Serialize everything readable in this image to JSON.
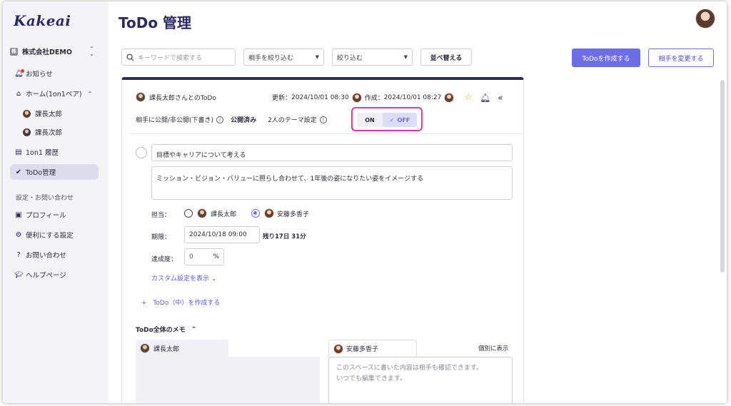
{
  "app": {
    "logo": "Kakeai"
  },
  "sidebar": {
    "company": "株式会社DEMO",
    "company_icon": "株",
    "items": [
      {
        "label": "お知らせ"
      },
      {
        "label": "ホーム(1on1ペア)"
      },
      {
        "label": "課長太郎"
      },
      {
        "label": "課長次郎"
      },
      {
        "label": "1on1 履歴"
      },
      {
        "label": "ToDo管理"
      }
    ],
    "section": "設定・お問い合わせ",
    "settings": [
      {
        "label": "プロフィール"
      },
      {
        "label": "便利にする設定"
      },
      {
        "label": "お問い合わせ"
      },
      {
        "label": "ヘルプページ"
      }
    ]
  },
  "header": {
    "title": "ToDo 管理"
  },
  "toolbar": {
    "search_placeholder": "キーワードで検索する",
    "filter_partner": "相手を絞り込む",
    "filter": "絞り込む",
    "sort": "並べ替える",
    "create": "ToDoを作成する",
    "change_partner": "相手を変更する"
  },
  "card": {
    "title": "課長太郎さんとのToDo",
    "updated_label": "更新：",
    "updated": "2024/10/01 08:30",
    "created_label": "作成：",
    "created": "2024/10/01 08:27",
    "visibility_label": "相手に公開/非公開(下書き)",
    "visibility_value": "公開済み",
    "theme_label": "2人のテーマ設定",
    "toggle_on": "ON",
    "toggle_off": "OFF",
    "goal": "目標やキャリアについて考える",
    "description": "ミッション・ビジョン・バリューに照らし合わせて、1年後の姿になりたい姿をイメージする",
    "assignee_label": "担当：",
    "assignee_1": "課長太郎",
    "assignee_2": "安藤多香子",
    "due_label": "期限：",
    "due_value": "2024/10/18 09:00",
    "remaining": "残り17日 31分",
    "progress_label": "達成度：",
    "progress_value": "0",
    "progress_unit": "%",
    "custom_link": "カスタム設定を表示",
    "add_sub": "ToDo（中）を作成する",
    "memo_title": "ToDo全体のメモ",
    "memo_left_name": "課長太郎",
    "memo_right_name": "安藤多香子",
    "memo_individual": "個別に表示",
    "memo_placeholder_1": "このスペースに書いた内容は相手も確認できます。",
    "memo_placeholder_2": "いつでも編集できます。"
  },
  "colors": {
    "accent": "#6d6ee6",
    "brand": "#2c2a5e",
    "highlight": "#e8339e"
  }
}
